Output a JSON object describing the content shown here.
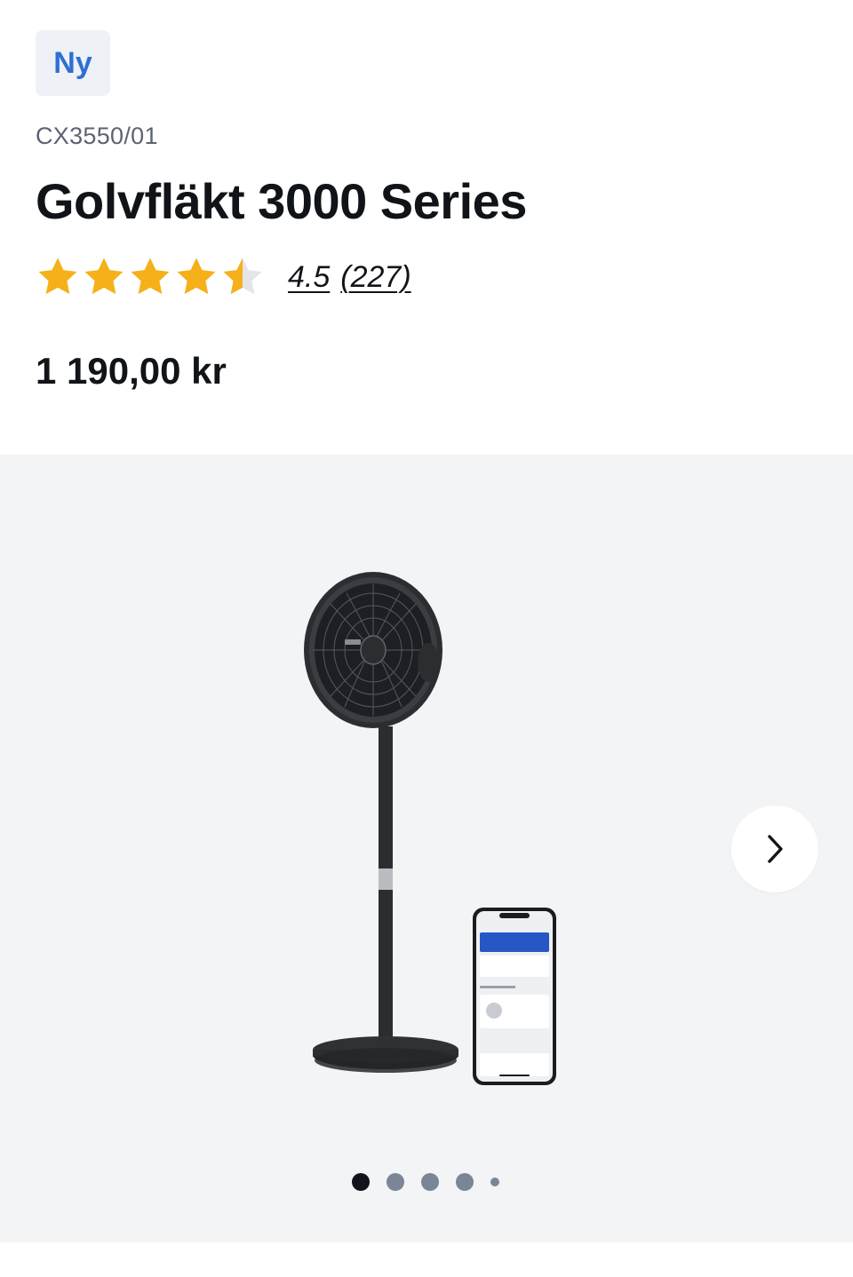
{
  "badge": {
    "label": "Ny",
    "color": "#2f6fd4"
  },
  "product": {
    "sku": "CX3550/01",
    "title": "Golvfläkt 3000 Series",
    "price": "1 190,00 kr"
  },
  "rating": {
    "value": 4.5,
    "max": 5,
    "score_label": "4.5",
    "count_label": "(227)",
    "star_color": "#f5b01a",
    "empty_star_color": "#e3e5e8"
  },
  "gallery": {
    "image_icon": "fan-product-with-phone-app",
    "next_icon": "chevron-right-icon",
    "slide_count": 5,
    "active_slide": 1
  }
}
